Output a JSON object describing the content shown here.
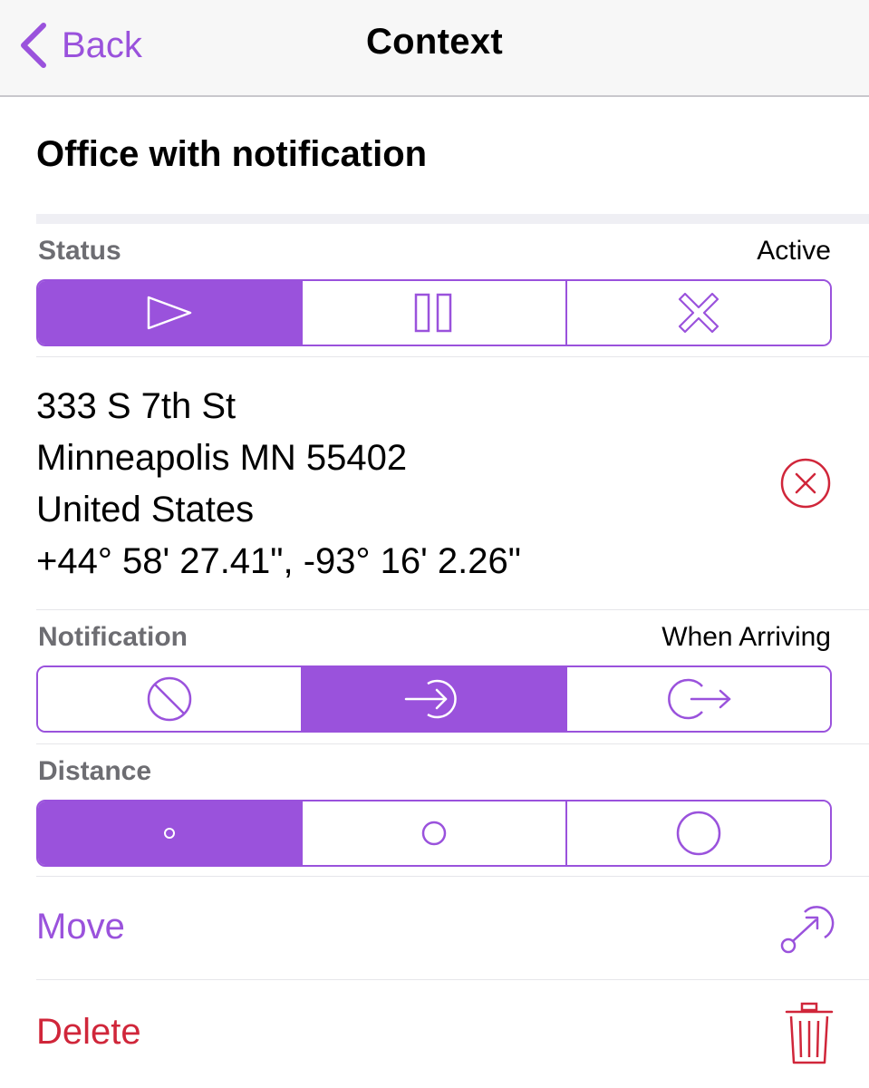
{
  "nav": {
    "back_label": "Back",
    "title": "Context"
  },
  "context_name": "Office with notification",
  "status": {
    "label": "Status",
    "value": "Active",
    "options": [
      "play-icon",
      "pause-icon",
      "x-cross-icon"
    ],
    "selected_index": 0
  },
  "address": {
    "line1": "333 S 7th St",
    "line2": "Minneapolis MN 55402",
    "line3": "United States",
    "coordinates": "+44° 58' 27.41\", -93° 16' 2.26\"",
    "clear_icon": "circle-x-icon"
  },
  "notification": {
    "label": "Notification",
    "value": "When Arriving",
    "options": [
      "no-notification-icon",
      "arriving-icon",
      "leaving-icon"
    ],
    "selected_index": 1
  },
  "distance": {
    "label": "Distance",
    "options": [
      "small-radius-icon",
      "medium-radius-icon",
      "large-radius-icon"
    ],
    "selected_index": 0
  },
  "actions": {
    "move_label": "Move",
    "move_icon": "move-pin-icon",
    "delete_label": "Delete",
    "delete_icon": "trash-icon"
  },
  "colors": {
    "accent": "#9a52dc",
    "destructive": "#d0263a",
    "secondary_text": "#6d6d72",
    "navbar_bg": "#f7f7f7"
  }
}
